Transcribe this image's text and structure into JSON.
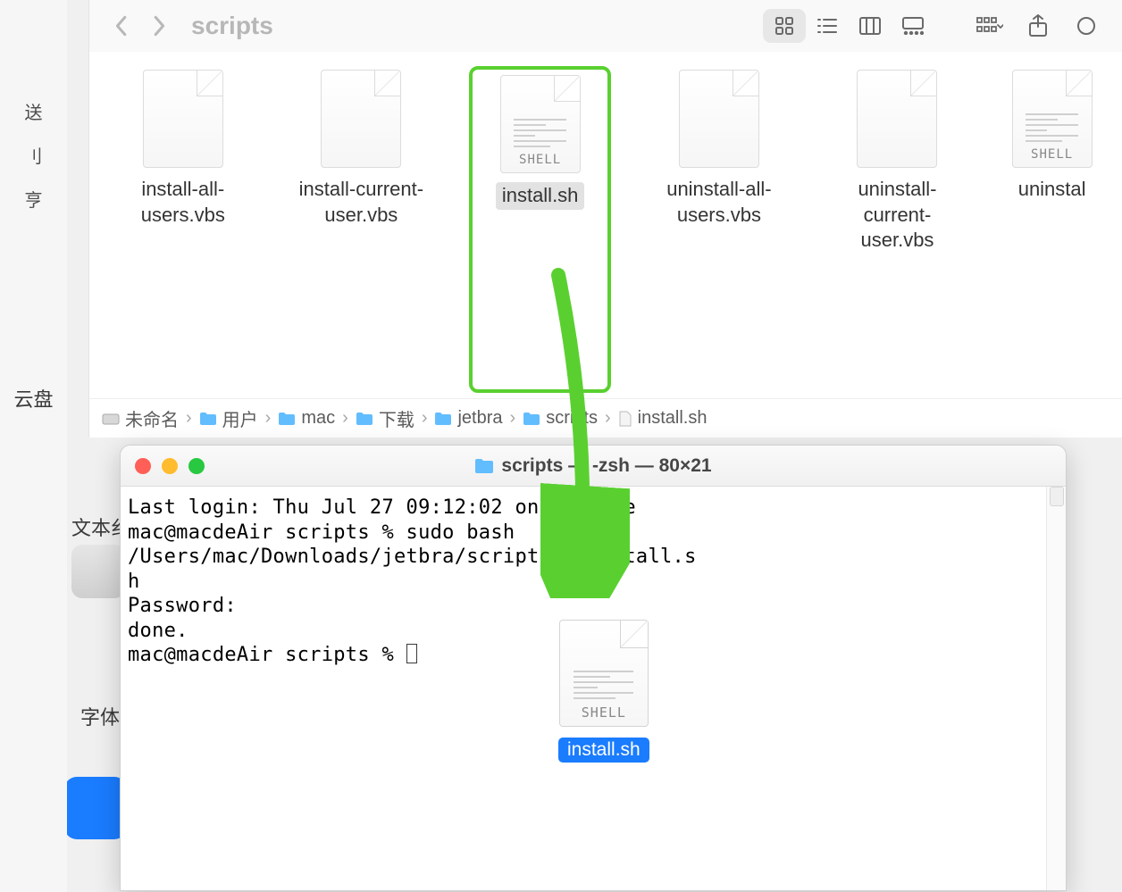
{
  "left_strip": {
    "char1": "送",
    "char2": "刂",
    "char3": "亨",
    "label_cloud": "云盘",
    "label_text": "文本纟",
    "label_font": "字体"
  },
  "finder": {
    "title": "scripts",
    "files": [
      {
        "name": "install-all-users.vbs",
        "type": "vbs"
      },
      {
        "name": "install-current-user.vbs",
        "type": "vbs"
      },
      {
        "name": "install.sh",
        "type": "shell",
        "selected": true
      },
      {
        "name": "uninstall-all-users.vbs",
        "type": "vbs"
      },
      {
        "name": "uninstall-current-user.vbs",
        "type": "vbs"
      },
      {
        "name": "uninstal",
        "type": "shell",
        "cut": true
      }
    ],
    "shell_tag": "SHELL",
    "path": [
      {
        "icon": "disk",
        "label": "未命名"
      },
      {
        "icon": "folder",
        "label": "用户"
      },
      {
        "icon": "folder",
        "label": "mac"
      },
      {
        "icon": "folder",
        "label": "下载"
      },
      {
        "icon": "folder",
        "label": "jetbra"
      },
      {
        "icon": "folder",
        "label": "scripts"
      },
      {
        "icon": "doc",
        "label": "install.sh"
      }
    ]
  },
  "terminal": {
    "title": "scripts — -zsh — 80×21",
    "lines": [
      "Last login: Thu Jul 27 09:12:02 on console",
      "mac@macdeAir scripts % sudo bash /Users/mac/Downloads/jetbra/scripts/uninstall.s",
      "h",
      "Password:",
      "done.",
      "mac@macdeAir scripts % "
    ]
  },
  "dragged_file": {
    "name": "install.sh",
    "tag": "SHELL"
  },
  "colors": {
    "accent_green": "#5ad030",
    "selection_blue": "#1a7cff"
  }
}
